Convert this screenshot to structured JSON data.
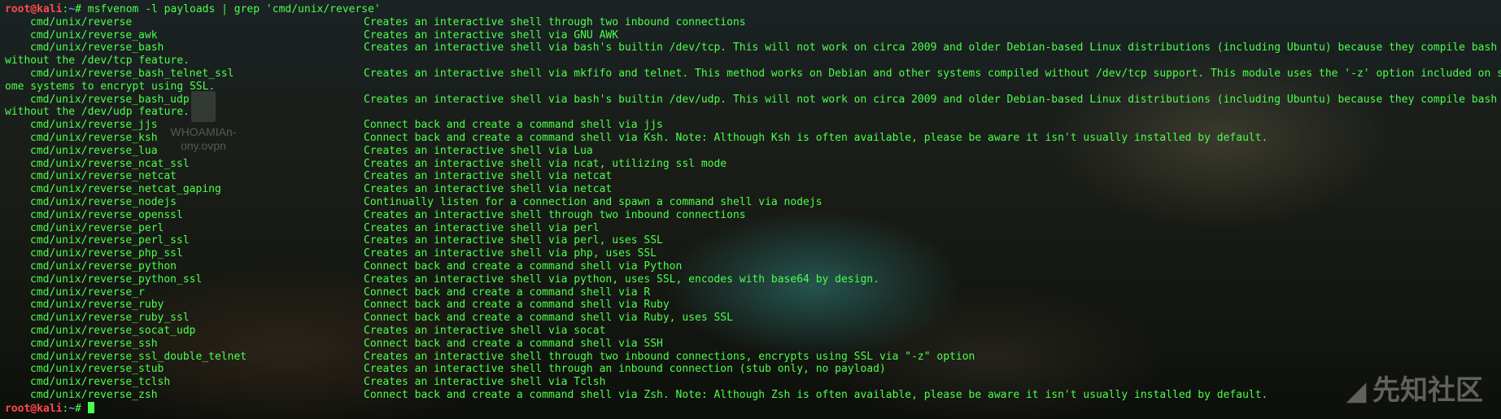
{
  "prompt": {
    "user": "root@kali",
    "sep": ":",
    "path": "~",
    "symbol": "# ",
    "command": "msfvenom -l payloads | grep 'cmd/unix/reverse'"
  },
  "payloads": [
    {
      "name": "cmd/unix/reverse",
      "description": "Creates an interactive shell through two inbound connections"
    },
    {
      "name": "cmd/unix/reverse_awk",
      "description": "Creates an interactive shell via GNU AWK"
    },
    {
      "name": "cmd/unix/reverse_bash",
      "description": "Creates an interactive shell via bash's builtin /dev/tcp. This will not work on circa 2009 and older Debian-based Linux distributions (including Ubuntu) because they compile bash",
      "wrap": "without the /dev/tcp feature."
    },
    {
      "name": "cmd/unix/reverse_bash_telnet_ssl",
      "description": "Creates an interactive shell via mkfifo and telnet. This method works on Debian and other systems compiled without /dev/tcp support. This module uses the '-z' option included on s",
      "wrap": "ome systems to encrypt using SSL."
    },
    {
      "name": "cmd/unix/reverse_bash_udp",
      "description": "Creates an interactive shell via bash's builtin /dev/udp. This will not work on circa 2009 and older Debian-based Linux distributions (including Ubuntu) because they compile bash",
      "wrap": "without the /dev/udp feature."
    },
    {
      "name": "cmd/unix/reverse_jjs",
      "description": "Connect back and create a command shell via jjs"
    },
    {
      "name": "cmd/unix/reverse_ksh",
      "description": "Connect back and create a command shell via Ksh. Note: Although Ksh is often available, please be aware it isn't usually installed by default."
    },
    {
      "name": "cmd/unix/reverse_lua",
      "description": "Creates an interactive shell via Lua"
    },
    {
      "name": "cmd/unix/reverse_ncat_ssl",
      "description": "Creates an interactive shell via ncat, utilizing ssl mode"
    },
    {
      "name": "cmd/unix/reverse_netcat",
      "description": "Creates an interactive shell via netcat"
    },
    {
      "name": "cmd/unix/reverse_netcat_gaping",
      "description": "Creates an interactive shell via netcat"
    },
    {
      "name": "cmd/unix/reverse_nodejs",
      "description": "Continually listen for a connection and spawn a command shell via nodejs"
    },
    {
      "name": "cmd/unix/reverse_openssl",
      "description": "Creates an interactive shell through two inbound connections"
    },
    {
      "name": "cmd/unix/reverse_perl",
      "description": "Creates an interactive shell via perl"
    },
    {
      "name": "cmd/unix/reverse_perl_ssl",
      "description": "Creates an interactive shell via perl, uses SSL"
    },
    {
      "name": "cmd/unix/reverse_php_ssl",
      "description": "Creates an interactive shell via php, uses SSL"
    },
    {
      "name": "cmd/unix/reverse_python",
      "description": "Connect back and create a command shell via Python"
    },
    {
      "name": "cmd/unix/reverse_python_ssl",
      "description": "Creates an interactive shell via python, uses SSL, encodes with base64 by design."
    },
    {
      "name": "cmd/unix/reverse_r",
      "description": "Connect back and create a command shell via R"
    },
    {
      "name": "cmd/unix/reverse_ruby",
      "description": "Connect back and create a command shell via Ruby"
    },
    {
      "name": "cmd/unix/reverse_ruby_ssl",
      "description": "Connect back and create a command shell via Ruby, uses SSL"
    },
    {
      "name": "cmd/unix/reverse_socat_udp",
      "description": "Creates an interactive shell via socat"
    },
    {
      "name": "cmd/unix/reverse_ssh",
      "description": "Connect back and create a command shell via SSH"
    },
    {
      "name": "cmd/unix/reverse_ssl_double_telnet",
      "description": "Creates an interactive shell through two inbound connections, encrypts using SSL via \"-z\" option"
    },
    {
      "name": "cmd/unix/reverse_stub",
      "description": "Creates an interactive shell through an inbound connection (stub only, no payload)"
    },
    {
      "name": "cmd/unix/reverse_tclsh",
      "description": "Creates an interactive shell via Tclsh"
    },
    {
      "name": "cmd/unix/reverse_zsh",
      "description": "Connect back and create a command shell via Zsh. Note: Although Zsh is often available, please be aware it isn't usually installed by default."
    }
  ],
  "desktop_icon": {
    "label": "WHOAMIAn-\nony.ovpn",
    "icon": "file-icon"
  },
  "watermark": {
    "text": "先知社区",
    "icon": "xianzhi-logo"
  },
  "colors": {
    "output": "#4cff4c",
    "user": "#ff4a4a",
    "path": "#6a8cff"
  }
}
